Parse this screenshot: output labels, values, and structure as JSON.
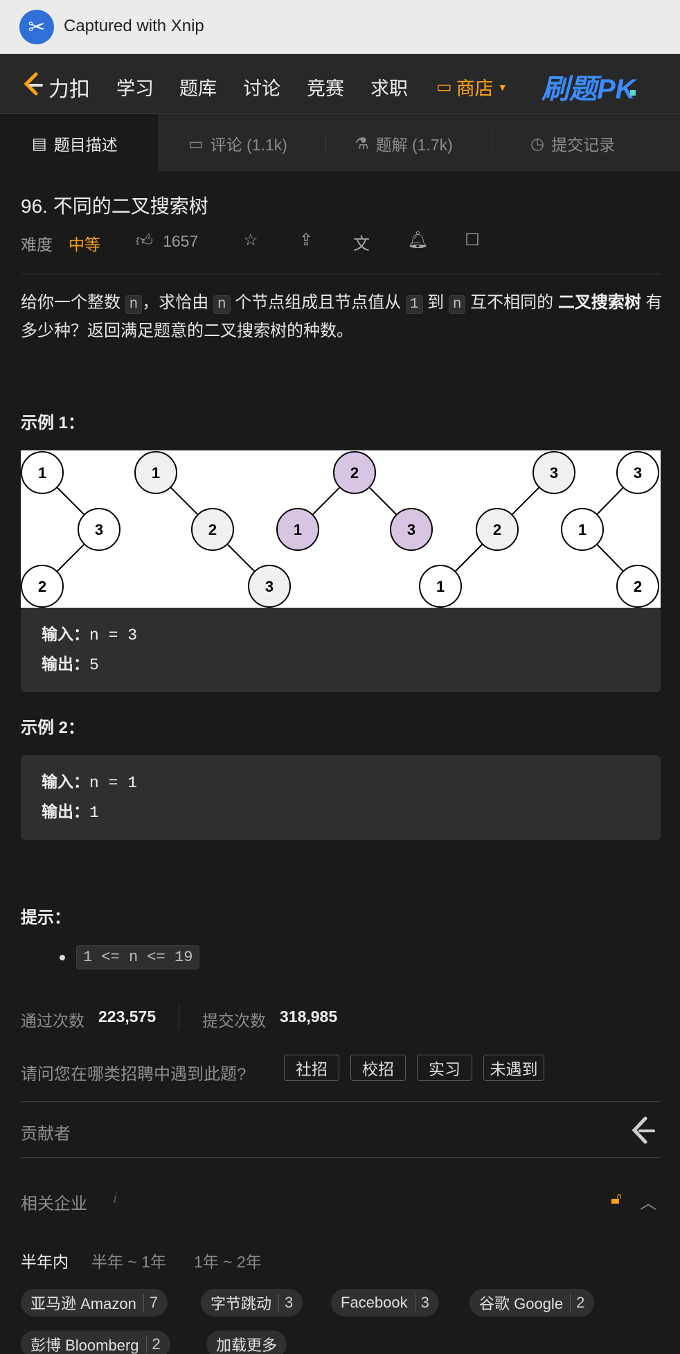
{
  "capture": {
    "text": "Captured with Xnip"
  },
  "nav": {
    "brand": "力扣",
    "items": [
      "学习",
      "题库",
      "讨论",
      "竞赛",
      "求职"
    ],
    "shop": "商店",
    "pk": "刷题PK"
  },
  "tabs": [
    "题目描述",
    "评论 (1.1k)",
    "题解 (1.7k)",
    "提交记录"
  ],
  "problem": {
    "title": "96. 不同的二叉搜索树",
    "difficulty_label": "难度",
    "difficulty": "中等",
    "likes": "1657",
    "desc": {
      "p1": "给你一个整数 ",
      "c1": "n",
      "p2": "，求恰由 ",
      "c2": "n",
      "p3": " 个节点组成且节点值从 ",
      "c3": "1",
      "p4": " 到 ",
      "c4": "n",
      "p5": " 互不相同的 ",
      "b1": "二叉搜索树",
      "p6": " 有多少种？返回满足题意的二叉搜索树的种数。"
    }
  },
  "examples": [
    {
      "title": "示例 1：",
      "in_label": "输入：",
      "in_val": "n = 3",
      "out_label": "输出：",
      "out_val": "5"
    },
    {
      "title": "示例 2：",
      "in_label": "输入：",
      "in_val": "n = 1",
      "out_label": "输出：",
      "out_val": "1"
    }
  ],
  "hints": {
    "title": "提示：",
    "items": [
      "1 <= n <= 19"
    ]
  },
  "stats": {
    "accepted_label": "通过次数",
    "accepted": "223,575",
    "submitted_label": "提交次数",
    "submitted": "318,985"
  },
  "survey": {
    "question": "请问您在哪类招聘中遇到此题?",
    "options": [
      "社招",
      "校招",
      "实习",
      "未遇到"
    ]
  },
  "contributors": {
    "label": "贡献者"
  },
  "companies": {
    "label": "相关企业",
    "info": "i",
    "periods": [
      "半年内",
      "半年 ~ 1年",
      "1年 ~ 2年"
    ],
    "chips": [
      {
        "name": "亚马逊 Amazon",
        "count": "7"
      },
      {
        "name": "字节跳动",
        "count": "3"
      },
      {
        "name": "Facebook",
        "count": "3"
      },
      {
        "name": "谷歌 Google",
        "count": "2"
      },
      {
        "name": "彭博 Bloomberg",
        "count": "2"
      }
    ],
    "more": "加载更多"
  },
  "trees": {
    "node_labels": [
      "1",
      "3",
      "2",
      "1",
      "2",
      "3",
      "2",
      "1",
      "3",
      "3",
      "2",
      "1",
      "3",
      "1",
      "2"
    ],
    "highlight_color": "#d8c4e3",
    "gray_color": "#f0f0f0"
  },
  "colors": {
    "accent": "#ffa116",
    "pk": "#3c8cff"
  }
}
